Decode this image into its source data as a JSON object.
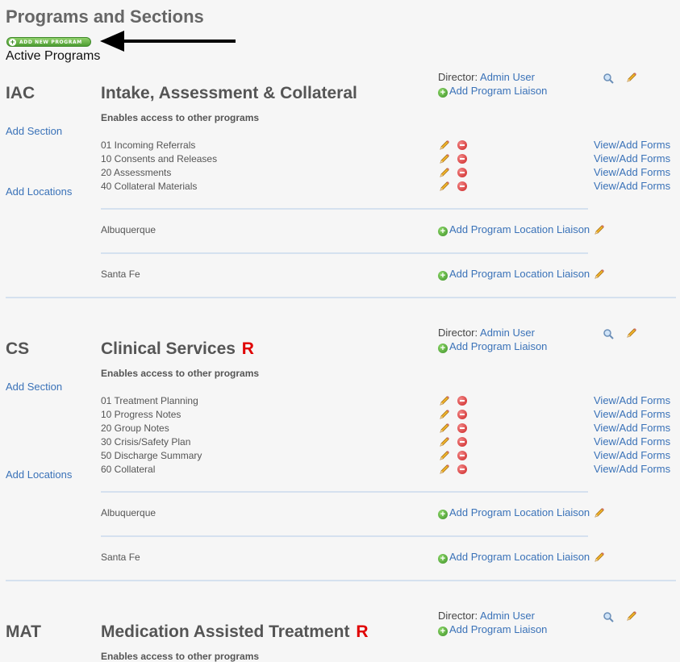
{
  "page": {
    "title": "Programs and Sections",
    "add_program_label": "ADD NEW PROGRAM",
    "active_heading": "Active Programs"
  },
  "labels": {
    "director_prefix": "Director:",
    "add_liaison": "Add Program Liaison",
    "subtitle": "Enables access to other programs",
    "add_section": "Add Section",
    "add_locations": "Add Locations",
    "view_forms": "View/Add Forms",
    "add_location_liaison": "Add Program Location Liaison",
    "restricted_marker": "R"
  },
  "programs": [
    {
      "abbr": "IAC",
      "title": "Intake, Assessment & Collateral",
      "restricted": false,
      "director": "Admin User",
      "sections": [
        "01 Incoming Referrals",
        "10 Consents and Releases",
        "20 Assessments",
        "40 Collateral Materials"
      ],
      "locations": [
        "Albuquerque",
        "Santa Fe"
      ]
    },
    {
      "abbr": "CS",
      "title": "Clinical Services",
      "restricted": true,
      "director": "Admin User",
      "sections": [
        "01 Treatment Planning",
        "10 Progress Notes",
        "20 Group Notes",
        "30 Crisis/Safety Plan",
        "50 Discharge Summary",
        "60 Collateral"
      ],
      "locations": [
        "Albuquerque",
        "Santa Fe"
      ]
    },
    {
      "abbr": "MAT",
      "title": "Medication Assisted Treatment",
      "restricted": true,
      "director": "Admin User",
      "sections": [],
      "locations": []
    }
  ],
  "colors": {
    "link": "#3a72b8",
    "restricted": "#e00000",
    "divider": "#d5e1ef",
    "add_green": "#4e9e33"
  }
}
